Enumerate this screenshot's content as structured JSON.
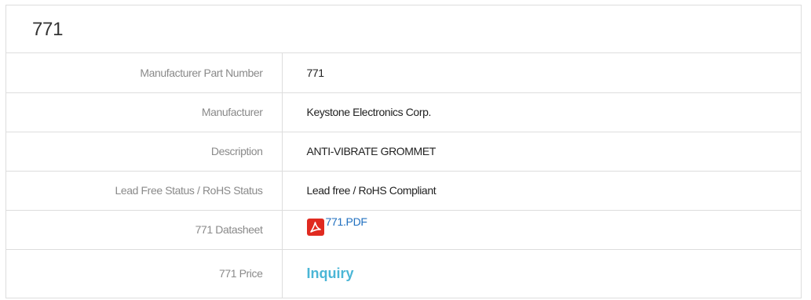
{
  "title": "771",
  "rows": [
    {
      "label": "Manufacturer Part Number",
      "value": "771"
    },
    {
      "label": "Manufacturer",
      "value": "Keystone Electronics Corp."
    },
    {
      "label": "Description",
      "value": "ANTI-VIBRATE GROMMET"
    },
    {
      "label": "Lead Free Status / RoHS Status",
      "value": "Lead free / RoHS Compliant"
    },
    {
      "label": "771 Datasheet",
      "link_text": "771.PDF",
      "icon": "pdf-icon"
    },
    {
      "label": "771 Price",
      "link_text": "Inquiry"
    }
  ],
  "colors": {
    "border": "#dddddd",
    "label_text": "#8a8a8a",
    "value_text": "#222222",
    "pdf_link": "#1f6fbf",
    "pdf_icon": "#e02a20",
    "inquiry": "#4bb6d6"
  }
}
